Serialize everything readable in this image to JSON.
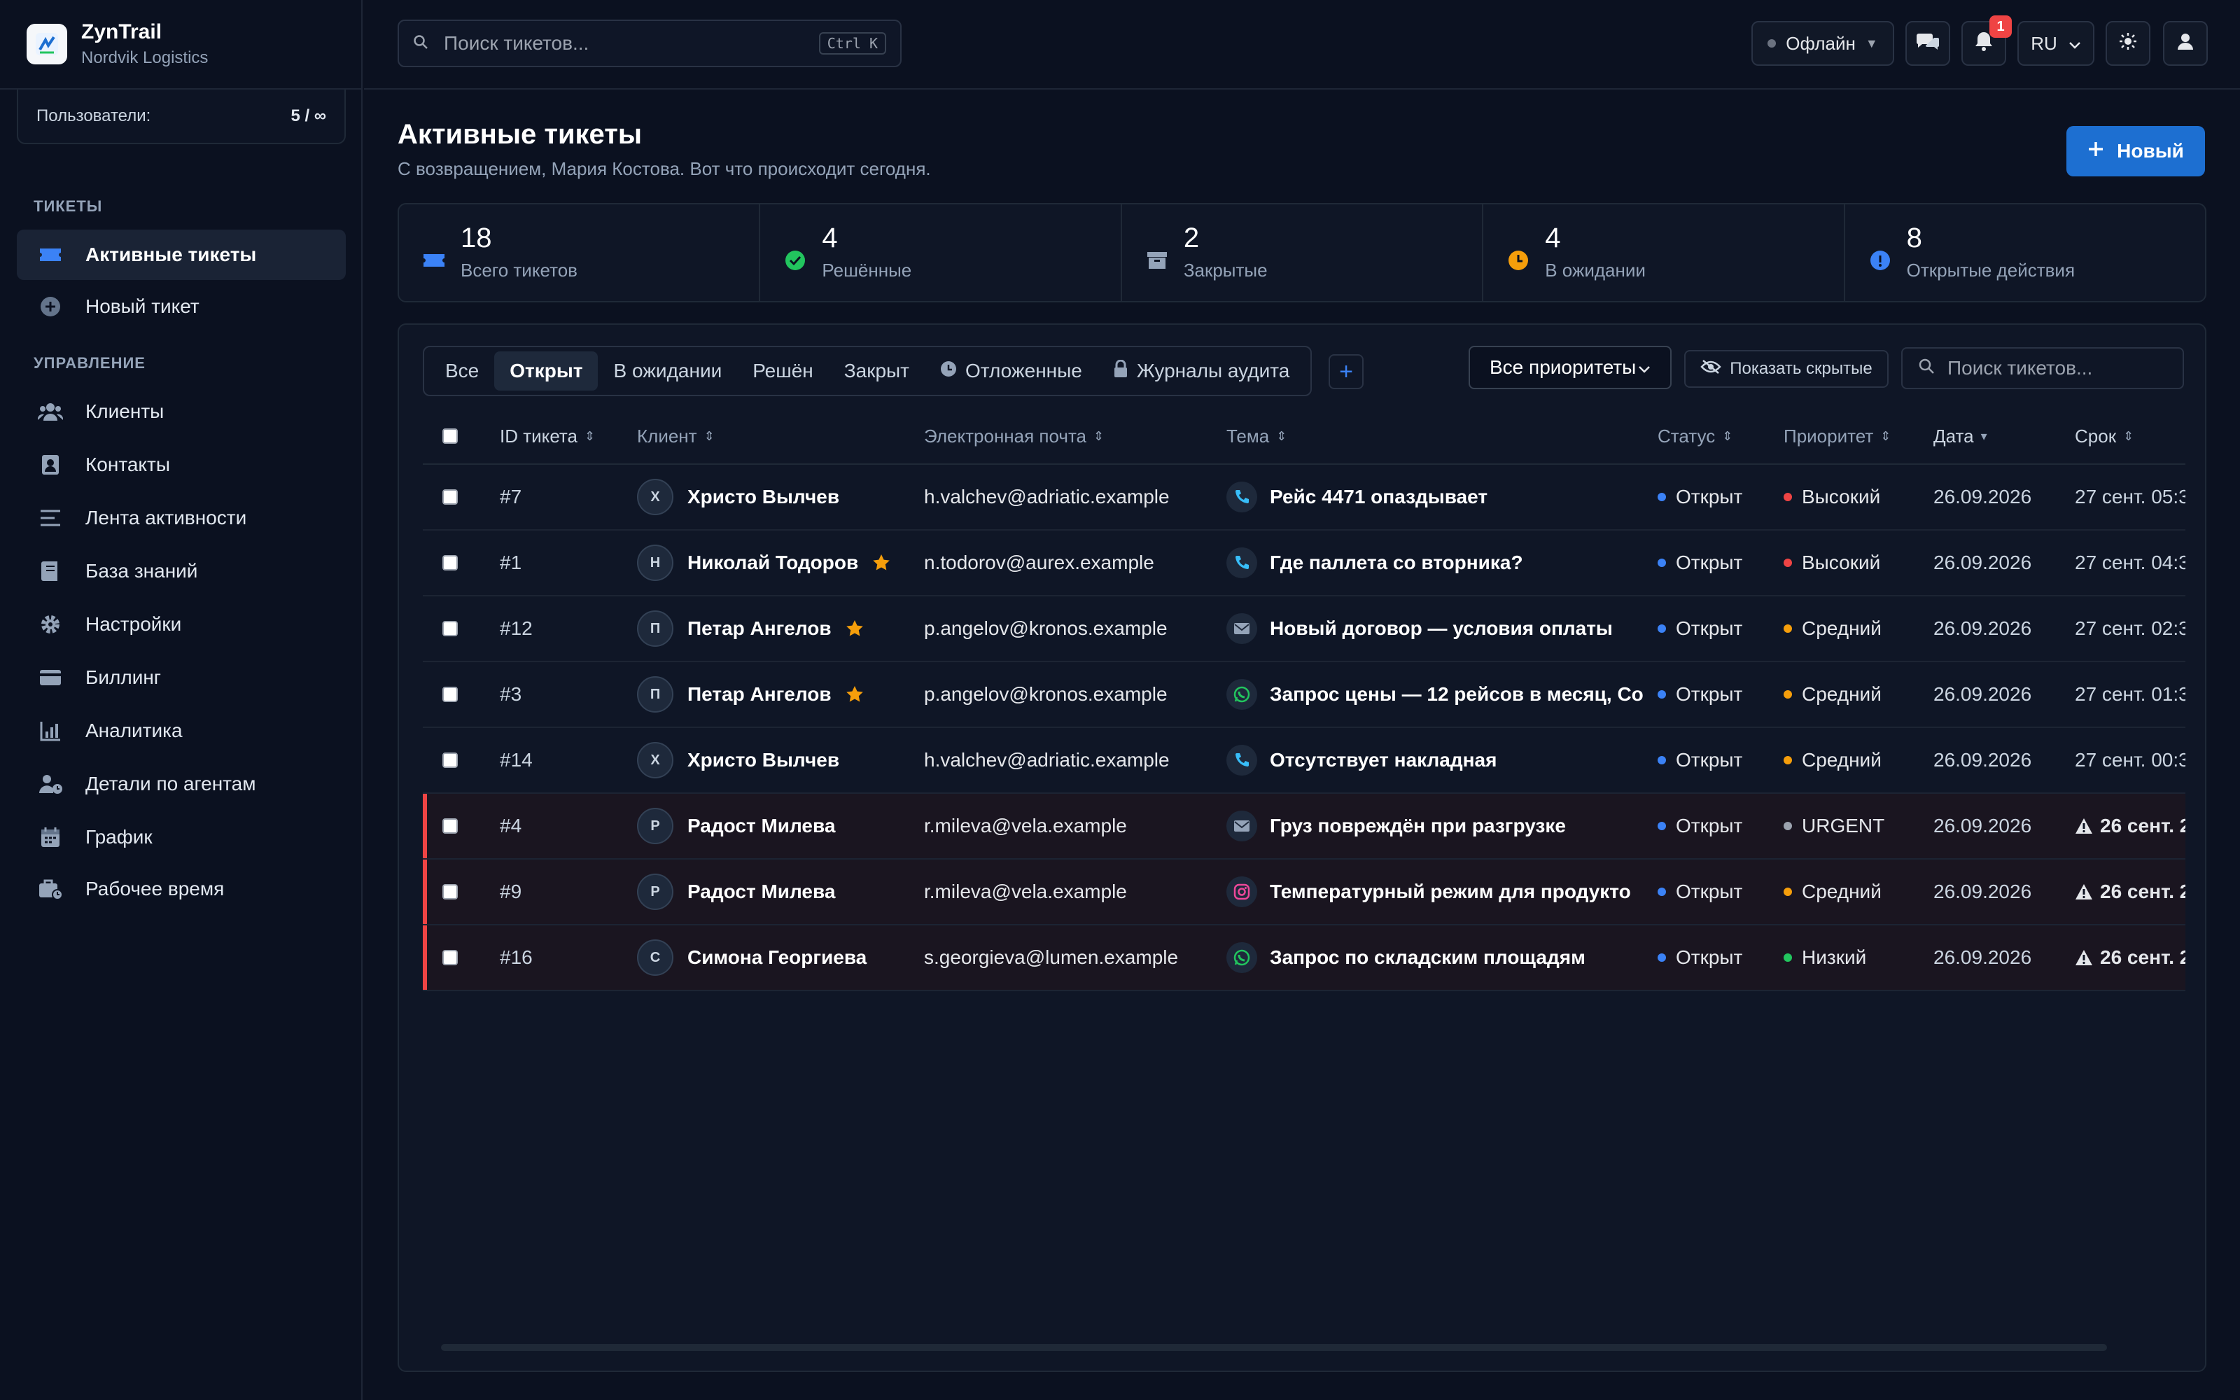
{
  "brand": {
    "app_name": "ZynTrail",
    "org_name": "Nordvik Logistics"
  },
  "users": {
    "label": "Пользователи:",
    "count": "5 / ∞"
  },
  "sidebar": {
    "sections": [
      {
        "title": "ТИКЕТЫ",
        "items": [
          {
            "label": "Активные тикеты",
            "icon": "ticket-icon",
            "active": true
          },
          {
            "label": "Новый тикет",
            "icon": "plus-circle-icon"
          }
        ]
      },
      {
        "title": "УПРАВЛЕНИЕ",
        "items": [
          {
            "label": "Клиенты",
            "icon": "users-icon"
          },
          {
            "label": "Контакты",
            "icon": "contact-card-icon"
          },
          {
            "label": "Лента активности",
            "icon": "feed-icon"
          },
          {
            "label": "База знаний",
            "icon": "book-icon"
          },
          {
            "label": "Настройки",
            "icon": "gear-icon"
          },
          {
            "label": "Биллинг",
            "icon": "credit-card-icon"
          },
          {
            "label": "Аналитика",
            "icon": "chart-icon"
          },
          {
            "label": "Детали по агентам",
            "icon": "agent-clock-icon"
          },
          {
            "label": "График",
            "icon": "calendar-icon"
          },
          {
            "label": "Рабочее время",
            "icon": "briefcase-clock-icon"
          }
        ]
      }
    ]
  },
  "topbar": {
    "search_placeholder": "Поиск тикетов...",
    "search_shortcut": "Ctrl K",
    "status": "Офлайн",
    "notifications_count": "1",
    "language": "RU"
  },
  "header": {
    "title": "Активные тикеты",
    "subtitle": "С возвращением, Мария Костова. Вот что происходит сегодня.",
    "new_button": "Новый"
  },
  "stats": [
    {
      "value": "18",
      "label": "Всего тикетов",
      "color": "#3b82f6",
      "icon": "ticket-icon"
    },
    {
      "value": "4",
      "label": "Решённые",
      "color": "#22c55e",
      "icon": "check-circle-icon"
    },
    {
      "value": "2",
      "label": "Закрытые",
      "color": "#94a3b8",
      "icon": "archive-icon"
    },
    {
      "value": "4",
      "label": "В ожидании",
      "color": "#f59e0b",
      "icon": "clock-icon"
    },
    {
      "value": "8",
      "label": "Открытые действия",
      "color": "#3b82f6",
      "icon": "info-icon"
    }
  ],
  "filters": {
    "tabs": [
      "Все",
      "Открыт",
      "В ожидании",
      "Решён",
      "Закрыт",
      "Отложенные",
      "Журналы аудита"
    ],
    "active_tab": "Открыт",
    "priority_select": "Все приоритеты",
    "show_hidden": "Показать скрытые",
    "search_placeholder": "Поиск тикетов..."
  },
  "table": {
    "columns": [
      "ID тикета",
      "Клиент",
      "Электронная почта",
      "Тема",
      "Статус",
      "Приоритет",
      "Дата",
      "Срок"
    ],
    "rows": [
      {
        "id": "#7",
        "initial": "Х",
        "client": "Христо Вылчев",
        "star": false,
        "email": "h.valchev@adriatic.example",
        "channel": "phone",
        "subject": "Рейс 4471 опаздывает",
        "status": "Открыт",
        "priority": "Высокий",
        "prio_color": "#ef4444",
        "date": "26.09.2026",
        "due": "27 сент. 05:3",
        "overdue": false
      },
      {
        "id": "#1",
        "initial": "Н",
        "client": "Николай Тодоров",
        "star": true,
        "email": "n.todorov@aurex.example",
        "channel": "phone",
        "subject": "Где паллета со вторника?",
        "status": "Открыт",
        "priority": "Высокий",
        "prio_color": "#ef4444",
        "date": "26.09.2026",
        "due": "27 сент. 04:3",
        "overdue": false
      },
      {
        "id": "#12",
        "initial": "П",
        "client": "Петар Ангелов",
        "star": true,
        "email": "p.angelov@kronos.example",
        "channel": "email",
        "subject": "Новый договор — условия оплаты",
        "status": "Открыт",
        "priority": "Средний",
        "prio_color": "#f59e0b",
        "date": "26.09.2026",
        "due": "27 сент. 02:3",
        "overdue": false
      },
      {
        "id": "#3",
        "initial": "П",
        "client": "Петар Ангелов",
        "star": true,
        "email": "p.angelov@kronos.example",
        "channel": "whatsapp",
        "subject": "Запрос цены — 12 рейсов в месяц, Со",
        "status": "Открыт",
        "priority": "Средний",
        "prio_color": "#f59e0b",
        "date": "26.09.2026",
        "due": "27 сент. 01:3",
        "overdue": false
      },
      {
        "id": "#14",
        "initial": "Х",
        "client": "Христо Вылчев",
        "star": false,
        "email": "h.valchev@adriatic.example",
        "channel": "phone",
        "subject": "Отсутствует накладная",
        "status": "Открыт",
        "priority": "Средний",
        "prio_color": "#f59e0b",
        "date": "26.09.2026",
        "due": "27 сент. 00:3",
        "overdue": false
      },
      {
        "id": "#4",
        "initial": "Р",
        "client": "Радост Милева",
        "star": false,
        "email": "r.mileva@vela.example",
        "channel": "email",
        "subject": "Груз повреждён при разгрузке",
        "status": "Открыт",
        "priority": "URGENT",
        "prio_color": "#9ca3af",
        "date": "26.09.2026",
        "due": "26 сент. 2",
        "overdue": true
      },
      {
        "id": "#9",
        "initial": "Р",
        "client": "Радост Милева",
        "star": false,
        "email": "r.mileva@vela.example",
        "channel": "instagram",
        "subject": "Температурный режим для продукто",
        "status": "Открыт",
        "priority": "Средний",
        "prio_color": "#f59e0b",
        "date": "26.09.2026",
        "due": "26 сент. 2",
        "overdue": true
      },
      {
        "id": "#16",
        "initial": "С",
        "client": "Симона Георгиева",
        "star": false,
        "email": "s.georgieva@lumen.example",
        "channel": "whatsapp",
        "subject": "Запрос по складским площадям",
        "status": "Открыт",
        "priority": "Низкий",
        "prio_color": "#22c55e",
        "date": "26.09.2026",
        "due": "26 сент. 2",
        "overdue": true
      }
    ]
  },
  "colors": {
    "accent": "#1d6fd1",
    "status_open": "#3b82f6",
    "overdue": "#ef4444"
  }
}
